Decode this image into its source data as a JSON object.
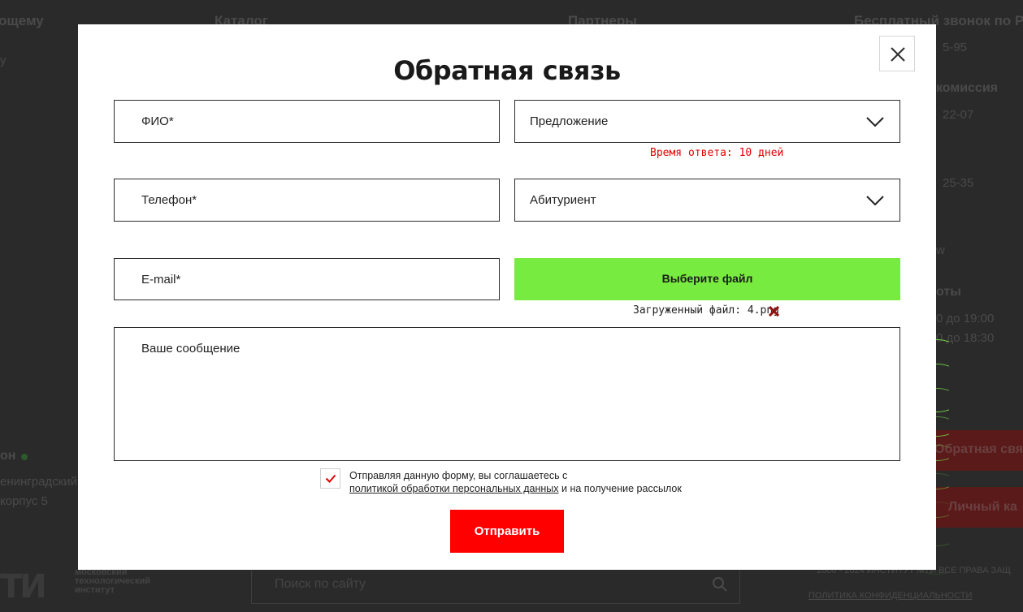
{
  "background": {
    "nav": [
      "ощему",
      "Каталог",
      "Партнеры",
      "Бесплатный звонок по Ро"
    ],
    "right_column": [
      "5-95",
      "комиссия",
      "22-07",
      "25-35",
      "w",
      "оты",
      "0 до 19:00",
      "0 до 18:30"
    ],
    "left_column": [
      "у",
      "он",
      "енинградский",
      "корпус 5"
    ],
    "logo_text": "ТИ",
    "logo_sub": [
      "московский",
      "технологический",
      "институт"
    ],
    "search_placeholder": "Поиск по сайту",
    "feedback_button": "Обратная свя",
    "cabinet_button": "Личный ка",
    "footer_rights": "2000 - 2024 ИНСТИТУТ МТИ ВСЕ ПРАВА ЗАЩ",
    "footer_policy": "ПОЛИТИКА КОНФИДЕНЦИАЛЬНОСТИ"
  },
  "modal": {
    "title": "Обратная связь",
    "fields": {
      "name": "ФИО*",
      "phone": "Телефон*",
      "email": "E-mail*",
      "message": "Ваше сообщение"
    },
    "selects": {
      "type": "Предложение",
      "role": "Абитуриент"
    },
    "response_time": "Время ответа: 10 дней",
    "file_button": "Выберите файл",
    "uploaded_file": "Загруженный файл: 4.png",
    "consent": {
      "line1": "Отправляя данную форму, вы соглашаетесь с",
      "link": "политикой обработки персональных данных",
      "line2_tail": " и на получение рассылок"
    },
    "submit": "Отправить"
  },
  "colors": {
    "accent_green": "#77eb3f",
    "accent_red": "#fe0000",
    "hint_red": "#e30000"
  },
  "icons": [
    "close-icon",
    "chevron-down-icon",
    "remove-file-icon",
    "check-icon",
    "search-icon"
  ]
}
